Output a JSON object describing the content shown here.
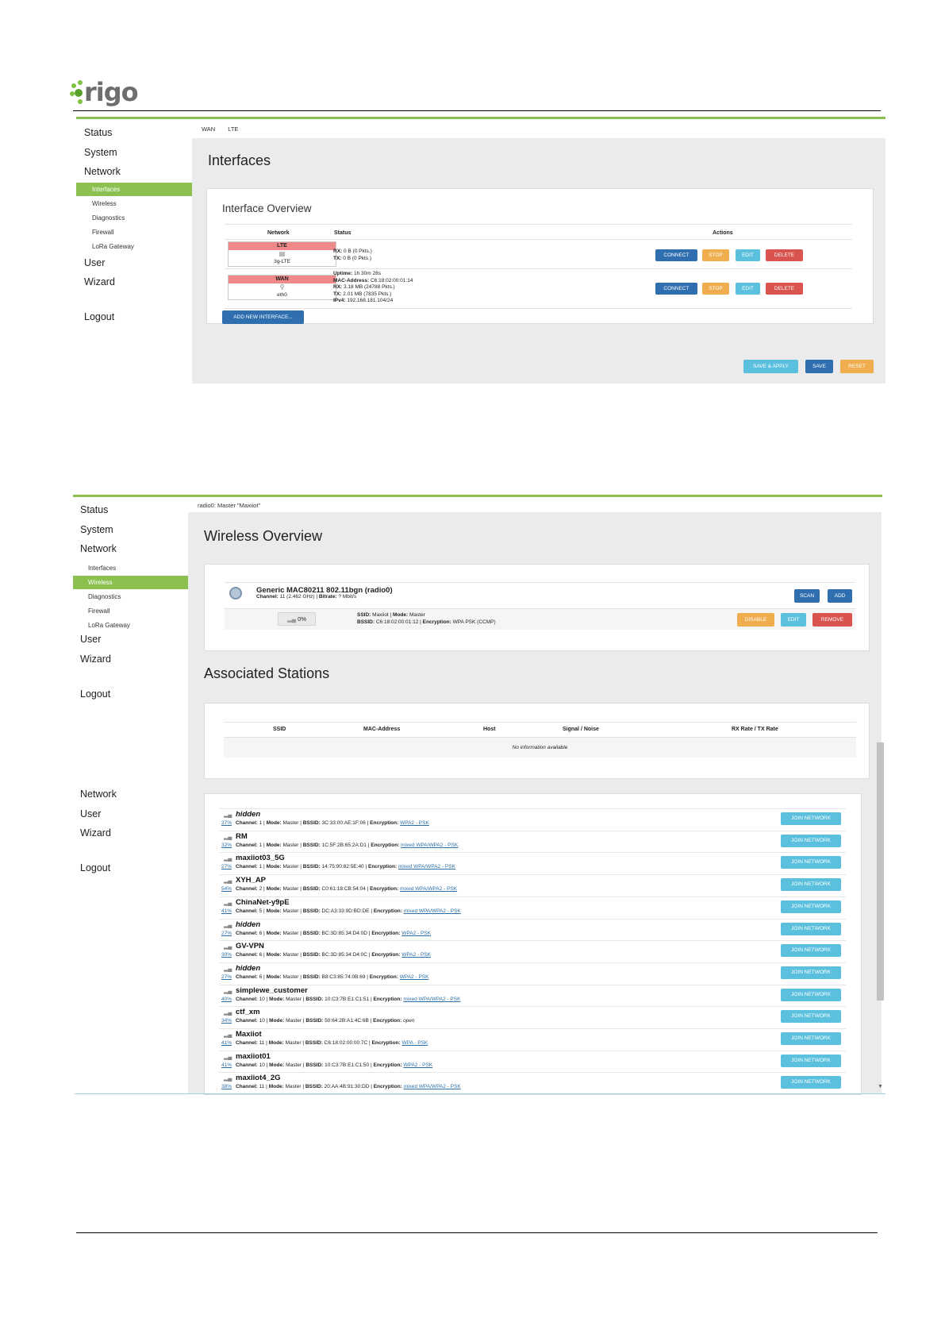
{
  "brand": {
    "logo_text": "rigo",
    "logo_full": "Origo",
    "accent_color": "#8cc152"
  },
  "screen1": {
    "sidebar": [
      "Status",
      "System",
      "Network",
      "User",
      "Wizard",
      "Logout"
    ],
    "subnav": [
      "Interfaces",
      "Wireless",
      "Diagnostics",
      "Firewall",
      "LoRa Gateway"
    ],
    "active_subnav": "Interfaces",
    "breadcrumbs": [
      "WAN",
      "LTE"
    ],
    "title": "Interfaces",
    "card_title": "Interface Overview",
    "table_headers": {
      "network": "Network",
      "status": "Status",
      "actions": "Actions"
    },
    "interfaces": [
      {
        "name": "LTE",
        "device": "3g-LTE",
        "status": [
          {
            "label": "RX:",
            "value": " 0 B (0 Pkts.)"
          },
          {
            "label": "TX:",
            "value": " 0 B (0 Pkts.)"
          }
        ]
      },
      {
        "name": "WAN",
        "device": "eth0",
        "status": [
          {
            "label": "Uptime:",
            "value": " 1h 30m 28s"
          },
          {
            "label": "MAC-Address:",
            "value": " C6:18:02:00:01:14"
          },
          {
            "label": "RX:",
            "value": " 3.18 MB (24788 Pkts.)"
          },
          {
            "label": "TX:",
            "value": " 2.01 MB (7835 Pkts.)"
          },
          {
            "label": "IPv4:",
            "value": " 192.168.181.104/24"
          }
        ]
      }
    ],
    "actions": {
      "connect": "CONNECT",
      "stop": "STOP",
      "edit": "EDIT",
      "delete": "DELETE"
    },
    "add_interface": "ADD NEW INTERFACE...",
    "footer_buttons": {
      "save_apply": "SAVE & APPLY",
      "save": "SAVE",
      "reset": "RESET"
    }
  },
  "screen2": {
    "sidebar": [
      "Status",
      "System",
      "Network",
      "User",
      "Wizard",
      "Logout"
    ],
    "subnav": [
      "Interfaces",
      "Wireless",
      "Diagnostics",
      "Firewall",
      "LoRa Gateway"
    ],
    "active_subnav": "Wireless",
    "breadcrumb": "radio0: Master \"Maxiiot\"",
    "title": "Wireless Overview",
    "radio": {
      "name": "Generic MAC80211 802.11bgn (radio0)",
      "channel_label": "Channel:",
      "channel_value": " 11 (2.462 GHz) | ",
      "bitrate_label": "Bitrate:",
      "bitrate_value": " ? Mbit/s",
      "scan": "SCAN",
      "add": "ADD"
    },
    "network": {
      "signal": "0%",
      "ssid_label": "SSID:",
      "ssid_value": " Maxiiot | ",
      "mode_label": "Mode:",
      "mode_value": " Master",
      "bssid_label": "BSSID:",
      "bssid_value": " C6:18:02:00:01:12 | ",
      "enc_label": "Encryption:",
      "enc_value": " WPA PSK (CCMP)",
      "disable": "DISABLE",
      "edit": "EDIT",
      "remove": "REMOVE"
    },
    "stations_title": "Associated Stations",
    "stations_headers": [
      "SSID",
      "MAC-Address",
      "Host",
      "Signal / Noise",
      "RX Rate / TX Rate"
    ],
    "stations_empty": "No information available"
  },
  "screen3": {
    "sidebar": [
      "Network",
      "User",
      "Wizard",
      "Logout"
    ],
    "labels": {
      "channel": "Channel:",
      "mode": "Mode:",
      "bssid": "BSSID:",
      "encryption": "Encryption:"
    },
    "join": "JOIN NETWORK",
    "scan_results": [
      {
        "ssid": "hidden",
        "italic": true,
        "signal": "37%",
        "channel": "1",
        "mode": "Master",
        "bssid": "3C:33:00:AE:1F:06",
        "encryption": "WPA2 - PSK",
        "enc_link": true
      },
      {
        "ssid": "RM",
        "italic": false,
        "signal": "32%",
        "channel": "1",
        "mode": "Master",
        "bssid": "1C:5F:2B:65:2A:D1",
        "encryption": "mixed WPA/WPA2 - PSK",
        "enc_link": true
      },
      {
        "ssid": "maxiiot03_5G",
        "italic": false,
        "signal": "27%",
        "channel": "1",
        "mode": "Master",
        "bssid": "14:75:90:82:5E:40",
        "encryption": "mixed WPA/WPA2 - PSK",
        "enc_link": true
      },
      {
        "ssid": "XYH_AP",
        "italic": false,
        "signal": "54%",
        "channel": "2",
        "mode": "Master",
        "bssid": "C0:61:18:CB:54:04",
        "encryption": "mixed WPA/WPA2 - PSK",
        "enc_link": true
      },
      {
        "ssid": "ChinaNet-y9pE",
        "italic": false,
        "signal": "41%",
        "channel": "5",
        "mode": "Master",
        "bssid": "DC:A3:33:9D:BD:DE",
        "encryption": "mixed WPA/WPA2 - PSK",
        "enc_link": true
      },
      {
        "ssid": "hidden",
        "italic": true,
        "signal": "27%",
        "channel": "6",
        "mode": "Master",
        "bssid": "BC:3D:85:34:D4:0D",
        "encryption": "WPA2 - PSK",
        "enc_link": true
      },
      {
        "ssid": "GV-VPN",
        "italic": false,
        "signal": "30%",
        "channel": "6",
        "mode": "Master",
        "bssid": "BC:3D:85:34:D4:0C",
        "encryption": "WPA2 - PSK",
        "enc_link": true
      },
      {
        "ssid": "hidden",
        "italic": true,
        "signal": "27%",
        "channel": "6",
        "mode": "Master",
        "bssid": "B8:C3:85:74:0B:69",
        "encryption": "WPA2 - PSK",
        "enc_link": true
      },
      {
        "ssid": "simplewe_customer",
        "italic": false,
        "signal": "40%",
        "channel": "10",
        "mode": "Master",
        "bssid": "10:C3:7B:E1:C1:51",
        "encryption": "mixed WPA/WPA2 - PSK",
        "enc_link": true
      },
      {
        "ssid": "ctf_xm",
        "italic": false,
        "signal": "34%",
        "channel": "10",
        "mode": "Master",
        "bssid": "50:64:2B:A1:4C:6B",
        "encryption": "open",
        "enc_link": false
      },
      {
        "ssid": "Maxiiot",
        "italic": false,
        "signal": "41%",
        "channel": "11",
        "mode": "Master",
        "bssid": "C6:18:02:00:00:7C",
        "encryption": "WPA - PSK",
        "enc_link": true
      },
      {
        "ssid": "maxiiot01",
        "italic": false,
        "signal": "41%",
        "channel": "10",
        "mode": "Master",
        "bssid": "10:C3:7B:E1:C1:50",
        "encryption": "WPA2 - PSK",
        "enc_link": true
      },
      {
        "ssid": "maxiiot4_2G",
        "italic": false,
        "signal": "38%",
        "channel": "11",
        "mode": "Master",
        "bssid": "20:AA:4B:91:30:DD",
        "encryption": "mixed WPA/WPA2 - PSK",
        "enc_link": true
      }
    ]
  }
}
